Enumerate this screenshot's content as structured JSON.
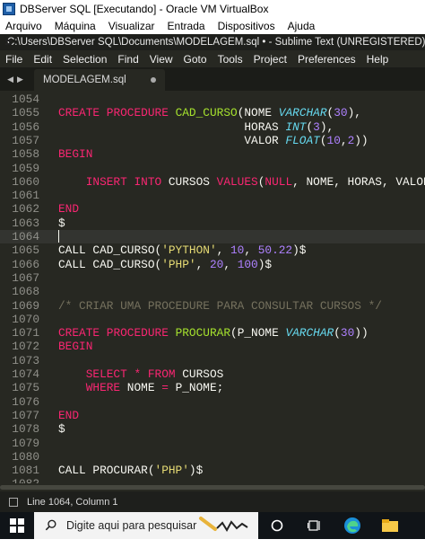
{
  "vbox": {
    "title": "DBServer SQL [Executando] - Oracle VM VirtualBox",
    "menu": [
      "Arquivo",
      "Máquina",
      "Visualizar",
      "Entrada",
      "Dispositivos",
      "Ajuda"
    ]
  },
  "sublime": {
    "title": "C:\\Users\\DBServer SQL\\Documents\\MODELAGEM.sql • - Sublime Text (UNREGISTERED)",
    "menu": [
      "File",
      "Edit",
      "Selection",
      "Find",
      "View",
      "Goto",
      "Tools",
      "Project",
      "Preferences",
      "Help"
    ],
    "tab": {
      "label": "MODELAGEM.sql",
      "modified": true
    },
    "status": "Line 1064, Column 1"
  },
  "editor": {
    "active_line": 1064,
    "lines": [
      {
        "n": "1054",
        "t": ""
      },
      {
        "n": "1055",
        "t": "CREATE PROCEDURE CAD_CURSO(NOME VARCHAR(30),"
      },
      {
        "n": "1056",
        "t": "                           HORAS INT(3),"
      },
      {
        "n": "1057",
        "t": "                           VALOR FLOAT(10,2))"
      },
      {
        "n": "1058",
        "t": "BEGIN"
      },
      {
        "n": "1059",
        "t": ""
      },
      {
        "n": "1060",
        "t": "    INSERT INTO CURSOS VALUES(NULL, NOME, HORAS, VALOR);"
      },
      {
        "n": "1061",
        "t": ""
      },
      {
        "n": "1062",
        "t": "END"
      },
      {
        "n": "1063",
        "t": "$"
      },
      {
        "n": "1064",
        "t": ""
      },
      {
        "n": "1065",
        "t": "CALL CAD_CURSO('PYTHON', 10, 50.22)$"
      },
      {
        "n": "1066",
        "t": "CALL CAD_CURSO('PHP', 20, 100)$"
      },
      {
        "n": "1067",
        "t": ""
      },
      {
        "n": "1068",
        "t": ""
      },
      {
        "n": "1069",
        "t": "/* CRIAR UMA PROCEDURE PARA CONSULTAR CURSOS */"
      },
      {
        "n": "1070",
        "t": ""
      },
      {
        "n": "1071",
        "t": "CREATE PROCEDURE PROCURAR(P_NOME VARCHAR(30))"
      },
      {
        "n": "1072",
        "t": "BEGIN"
      },
      {
        "n": "1073",
        "t": ""
      },
      {
        "n": "1074",
        "t": "    SELECT * FROM CURSOS"
      },
      {
        "n": "1075",
        "t": "    WHERE NOME = P_NOME;"
      },
      {
        "n": "1076",
        "t": ""
      },
      {
        "n": "1077",
        "t": "END"
      },
      {
        "n": "1078",
        "t": "$"
      },
      {
        "n": "1079",
        "t": ""
      },
      {
        "n": "1080",
        "t": ""
      },
      {
        "n": "1081",
        "t": "CALL PROCURAR('PHP')$"
      },
      {
        "n": "1082",
        "t": ""
      }
    ]
  },
  "taskbar": {
    "search_placeholder": "Digite aqui para pesquisar"
  },
  "colors": {
    "keyword": "#f92672",
    "function": "#a6e22e",
    "type": "#66d9ef",
    "number": "#ae81ff",
    "string": "#e6db74",
    "comment": "#75715e",
    "background": "#272822"
  }
}
